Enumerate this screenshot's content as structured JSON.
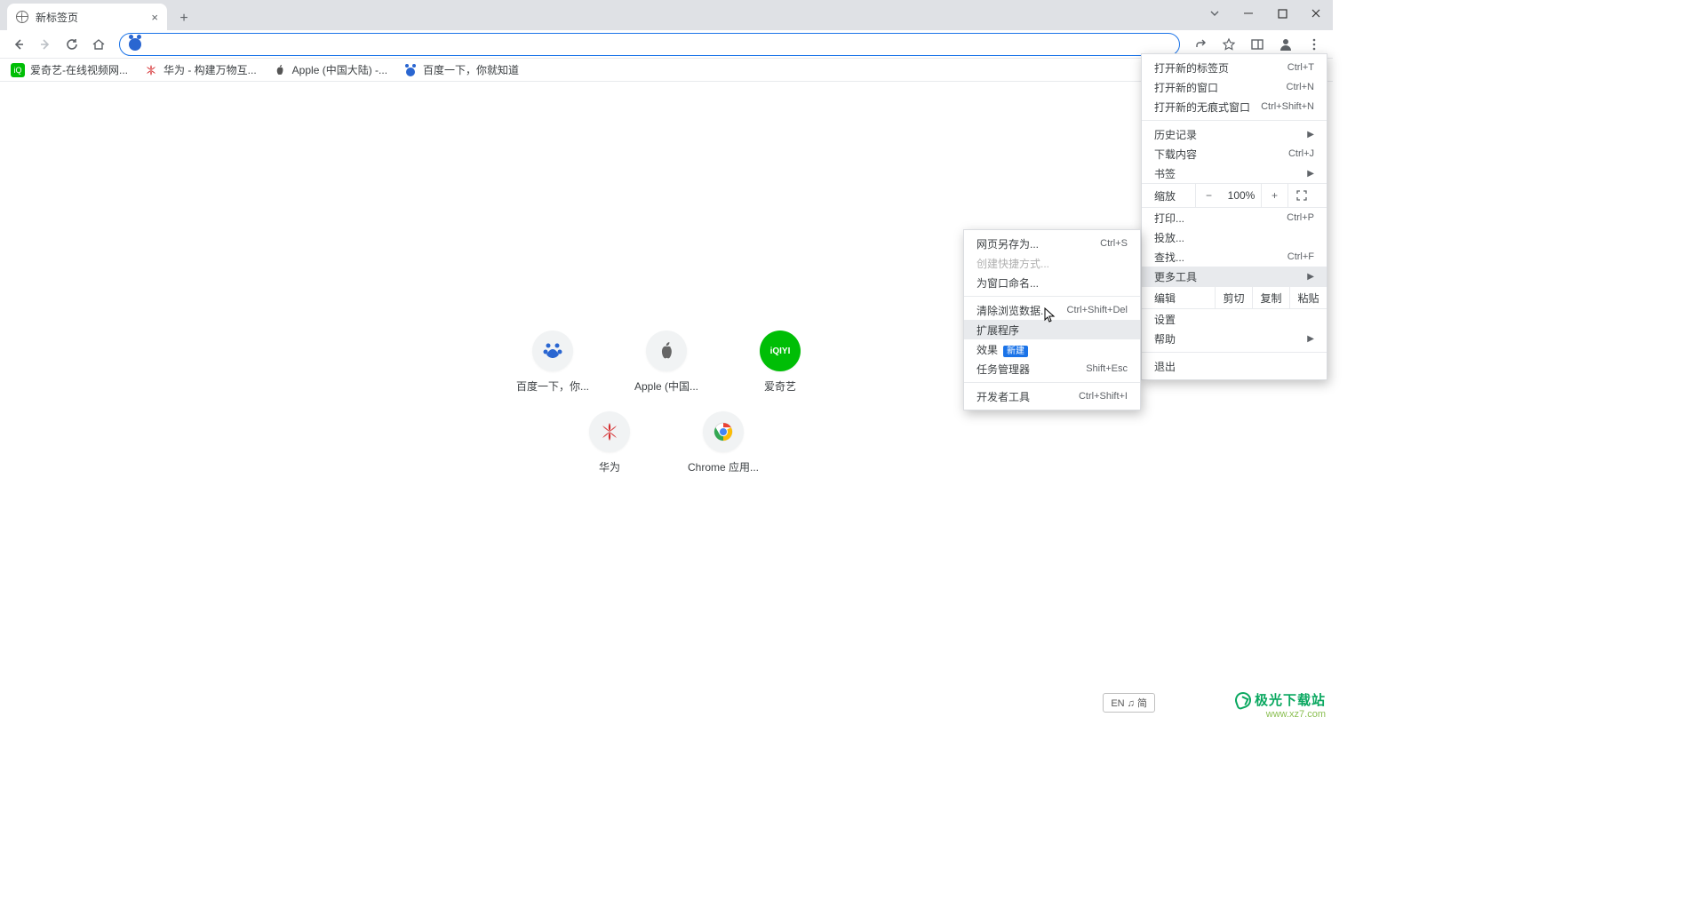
{
  "tab": {
    "title": "新标签页"
  },
  "bookmarks": [
    {
      "label": "爱奇艺-在线视频网...",
      "color": "#00be06"
    },
    {
      "label": "华为 - 构建万物互...",
      "color": "#d4292b"
    },
    {
      "label": "Apple (中国大陆) -...",
      "color": "#555"
    },
    {
      "label": "百度一下，你就知道",
      "color": "#2a66d1"
    }
  ],
  "shortcuts": {
    "row1": [
      {
        "label": "百度一下，你...",
        "type": "baidu"
      },
      {
        "label": "Apple (中国...",
        "type": "apple"
      },
      {
        "label": "爱奇艺",
        "type": "iqiyi"
      }
    ],
    "row2": [
      {
        "label": "华为",
        "type": "huawei"
      },
      {
        "label": "Chrome 应用...",
        "type": "chrome"
      }
    ]
  },
  "menu": {
    "new_tab": "打开新的标签页",
    "new_tab_key": "Ctrl+T",
    "new_window": "打开新的窗口",
    "new_window_key": "Ctrl+N",
    "incognito": "打开新的无痕式窗口",
    "incognito_key": "Ctrl+Shift+N",
    "history": "历史记录",
    "downloads": "下载内容",
    "downloads_key": "Ctrl+J",
    "bookmarks": "书签",
    "zoom": "缩放",
    "zoom_val": "100%",
    "print": "打印...",
    "print_key": "Ctrl+P",
    "cast": "投放...",
    "find": "查找...",
    "find_key": "Ctrl+F",
    "more_tools": "更多工具",
    "edit": "编辑",
    "cut": "剪切",
    "copy": "复制",
    "paste": "粘贴",
    "settings": "设置",
    "help": "帮助",
    "exit": "退出"
  },
  "submenu": {
    "save_as": "网页另存为...",
    "save_as_key": "Ctrl+S",
    "create_shortcut": "创建快捷方式...",
    "name_window": "为窗口命名...",
    "clear_data": "清除浏览数据...",
    "clear_data_key": "Ctrl+Shift+Del",
    "extensions": "扩展程序",
    "performance": "效果",
    "perf_badge": "新建",
    "task_manager": "任务管理器",
    "task_manager_key": "Shift+Esc",
    "dev_tools": "开发者工具",
    "dev_tools_key": "Ctrl+Shift+I"
  },
  "ime": "EN ♫ 简",
  "watermark": {
    "line1": "极光下载站",
    "line2": "www.xz7.com"
  }
}
